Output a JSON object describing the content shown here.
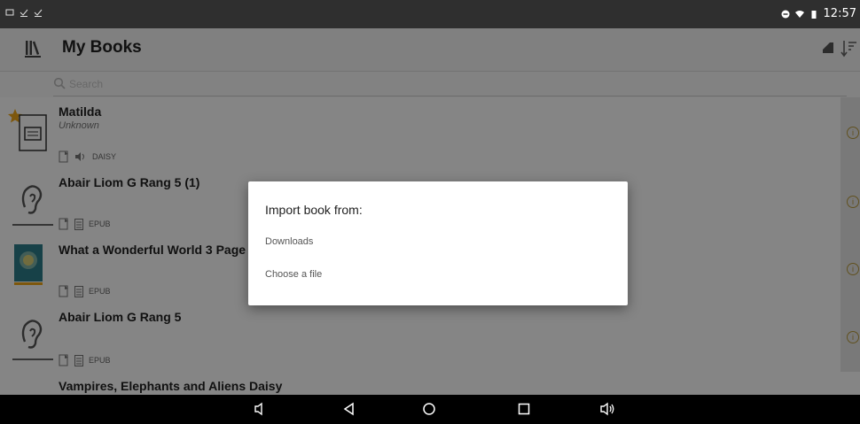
{
  "status": {
    "time": "12:57"
  },
  "appbar": {
    "title": "My Books",
    "menu_icon": "library-icon",
    "import_icon": "import-icon",
    "sort_icon": "sort-icon"
  },
  "search": {
    "placeholder": "Search"
  },
  "books": [
    {
      "title": "Matilda",
      "author": "Unknown",
      "format": "DAISY",
      "starred": true
    },
    {
      "title": "Abair Liom G Rang 5 (1)",
      "author": "",
      "format": "EPUB"
    },
    {
      "title": "What a Wonderful World 3 Page",
      "author": "",
      "format": "EPUB"
    },
    {
      "title": "Abair Liom G Rang 5",
      "author": "",
      "format": "EPUB"
    },
    {
      "title": "Vampires, Elephants and Aliens Daisy",
      "author": "",
      "format": ""
    }
  ],
  "dialog": {
    "title": "Import book from:",
    "options": [
      "Downloads",
      "Choose a file"
    ]
  },
  "colors": {
    "accent_star": "#f0a818",
    "dialog_bg": "#ffffff",
    "info_accent": "#b89a3a"
  }
}
